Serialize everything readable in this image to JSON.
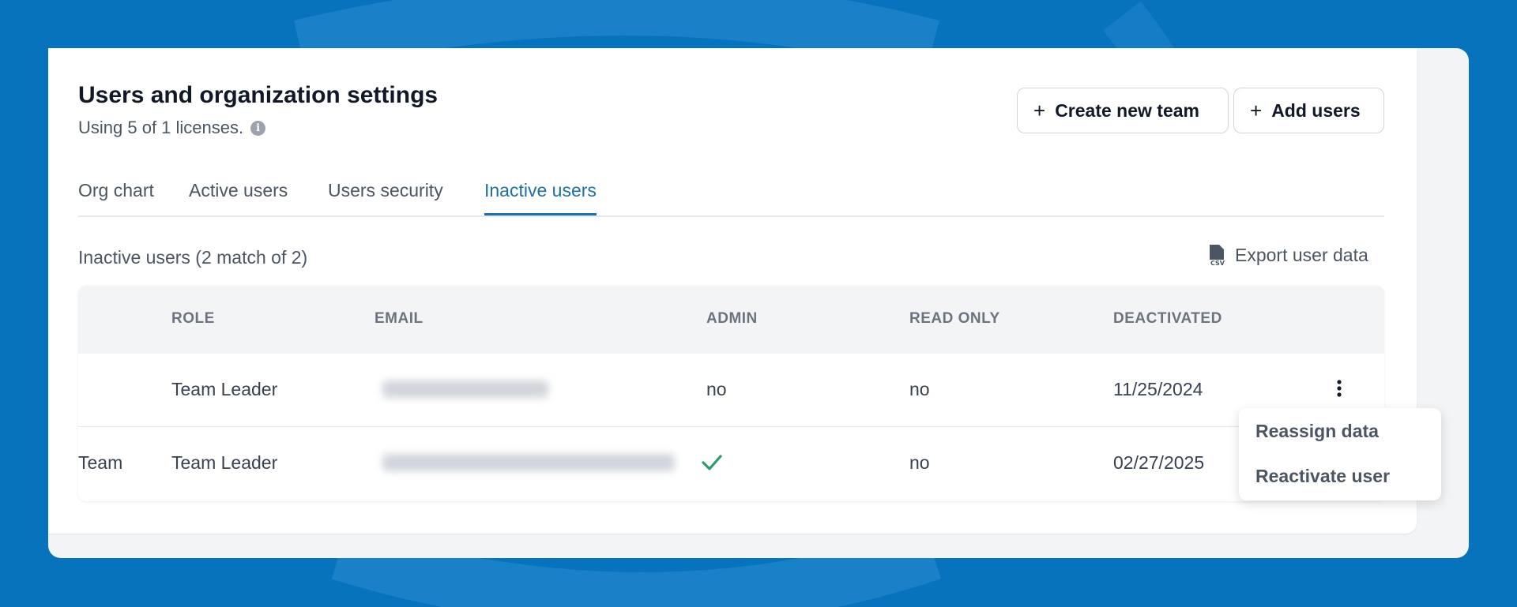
{
  "header": {
    "title": "Users and organization settings",
    "subtitle": "Using 5 of 1 licenses.",
    "info_icon": "info-icon",
    "create_team_label": "Create new team",
    "add_users_label": "Add users"
  },
  "tabs": [
    {
      "label": "Org chart",
      "active": false
    },
    {
      "label": "Active users",
      "active": false
    },
    {
      "label": "Users security",
      "active": false
    },
    {
      "label": "Inactive users",
      "active": true
    }
  ],
  "list": {
    "count_label": "Inactive users (2 match of 2)",
    "export_label": "Export user data",
    "export_icon": "csv-file-icon"
  },
  "table": {
    "columns": [
      "",
      "ROLE",
      "EMAIL",
      "ADMIN",
      "READ ONLY",
      "DEACTIVATED"
    ],
    "rows": [
      {
        "team": "",
        "role": "Team Leader",
        "email": "(blurred)",
        "admin": "no",
        "read_only": "no",
        "deactivated": "11/25/2024"
      },
      {
        "team": "Team",
        "role": "Team Leader",
        "email": "(blurred)",
        "admin": "check-icon",
        "read_only": "no",
        "deactivated": "02/27/2025"
      }
    ]
  },
  "context_menu": {
    "items": [
      "Reassign data",
      "Reactivate user"
    ]
  },
  "colors": {
    "background": "#0873bd",
    "accent": "#1d6fa8",
    "check": "#2e9b6a"
  }
}
